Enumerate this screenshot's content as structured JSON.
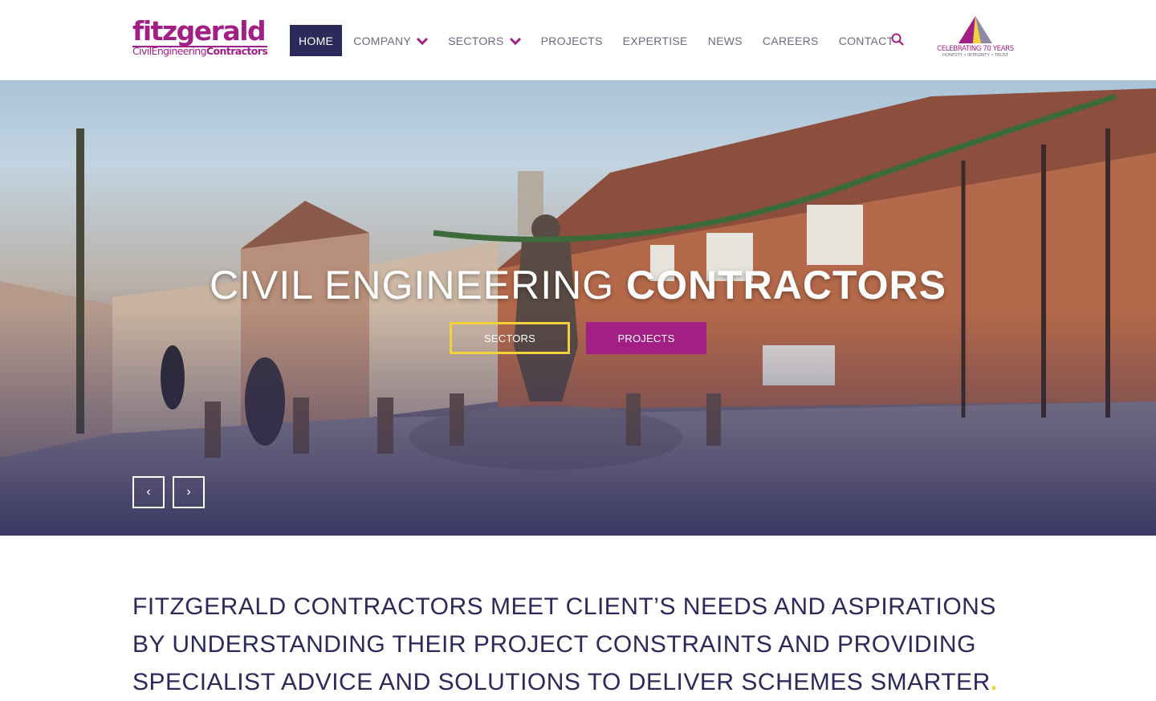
{
  "brand": {
    "name": "fitzgerald",
    "tagline_a": "CivilEngineering",
    "tagline_b": "Contractors",
    "purple": "#a21f86",
    "navy": "#2b2a5a",
    "yellow": "#f2d23a"
  },
  "nav": {
    "items": [
      {
        "label": "HOME",
        "active": true,
        "dropdown": false
      },
      {
        "label": "COMPANY",
        "active": false,
        "dropdown": true
      },
      {
        "label": "SECTORS",
        "active": false,
        "dropdown": true
      },
      {
        "label": "PROJECTS",
        "active": false,
        "dropdown": false
      },
      {
        "label": "EXPERTISE",
        "active": false,
        "dropdown": false
      },
      {
        "label": "NEWS",
        "active": false,
        "dropdown": false
      },
      {
        "label": "CAREERS",
        "active": false,
        "dropdown": false
      },
      {
        "label": "CONTACT",
        "active": false,
        "dropdown": false
      }
    ],
    "search_icon": "search-icon"
  },
  "badge": {
    "title": "CELEBRATING 70 YEARS",
    "subtitle": "HONESTY • INTEGRITY • TRUST"
  },
  "hero": {
    "title_light": "CIVIL ENGINEERING ",
    "title_bold": "CONTRACTORS",
    "buttons": {
      "sectors": "SECTORS",
      "projects": "PROJECTS"
    },
    "prev_icon": "chevron-left-icon",
    "next_icon": "chevron-right-icon",
    "prev_glyph": "‹",
    "next_glyph": "›"
  },
  "intro": {
    "text": "FITZGERALD CONTRACTORS MEET CLIENT’S NEEDS AND ASPIRATIONS BY UNDERSTANDING THEIR PROJECT CONSTRAINTS AND PROVIDING SPECIALIST ADVICE AND SOLUTIONS TO DELIVER SCHEMES SMARTER",
    "dot": "."
  }
}
